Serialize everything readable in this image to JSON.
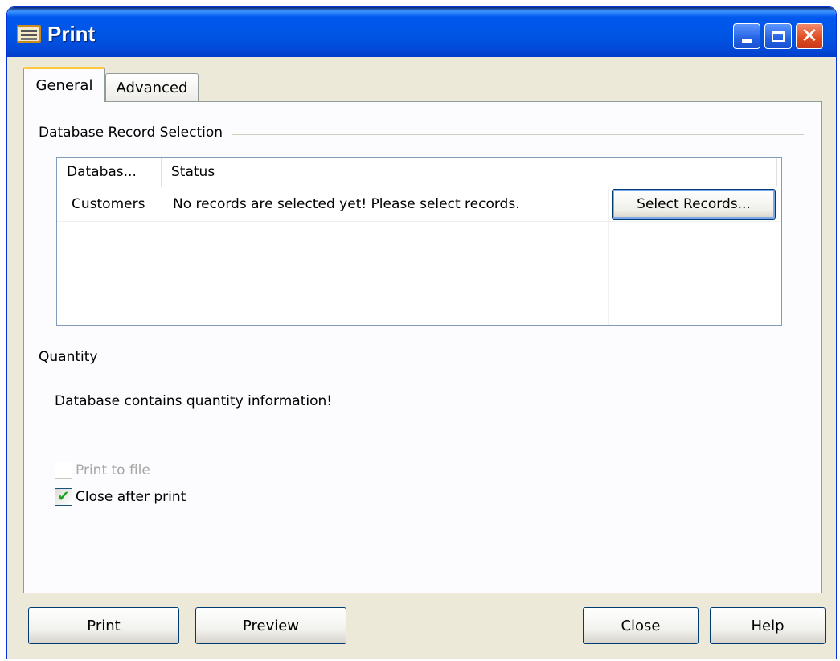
{
  "window": {
    "title": "Print",
    "icon": "keyboard-icon",
    "title_color": "#0054e3",
    "close_color": "#de4a1f"
  },
  "tabs": [
    {
      "label": "General",
      "selected": true
    },
    {
      "label": "Advanced",
      "selected": false
    }
  ],
  "record_selection": {
    "title": "Database Record Selection",
    "columns": [
      "Databas...",
      "Status",
      ""
    ],
    "rows": [
      {
        "database": "Customers",
        "status": "No records are selected yet! Please select records.",
        "action": "Select Records..."
      }
    ]
  },
  "quantity": {
    "title": "Quantity",
    "info": "Database contains quantity information!",
    "print_to_file": {
      "label": "Print to file",
      "checked": false,
      "enabled": false
    },
    "close_after_print": {
      "label": "Close after print",
      "checked": true,
      "enabled": true
    }
  },
  "buttons": {
    "print": "Print",
    "preview": "Preview",
    "close": "Close",
    "help": "Help"
  }
}
